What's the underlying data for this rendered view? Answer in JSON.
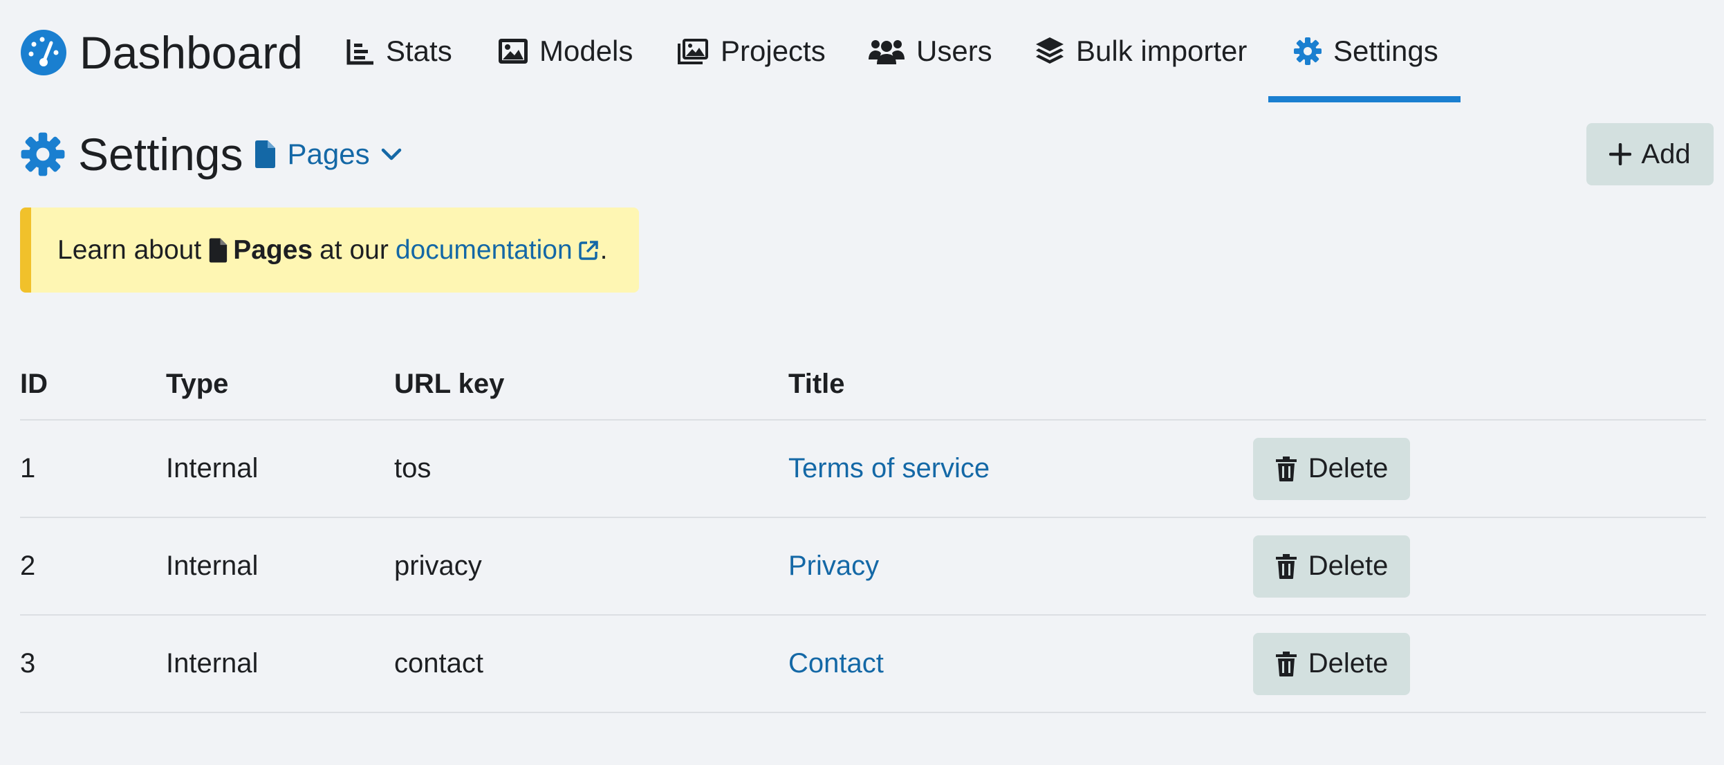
{
  "nav": {
    "brand": "Dashboard",
    "items": [
      {
        "label": "Stats",
        "icon": "chart-icon"
      },
      {
        "label": "Models",
        "icon": "image-icon"
      },
      {
        "label": "Projects",
        "icon": "images-icon"
      },
      {
        "label": "Users",
        "icon": "users-icon"
      },
      {
        "label": "Bulk importer",
        "icon": "layers-icon"
      },
      {
        "label": "Settings",
        "icon": "gear-icon"
      }
    ],
    "active": "Settings"
  },
  "header": {
    "title": "Settings",
    "section": "Pages",
    "add_label": "Add"
  },
  "callout": {
    "prefix": "Learn about",
    "entity": "Pages",
    "middle": "at our",
    "link": "documentation",
    "suffix": "."
  },
  "table": {
    "columns": [
      "ID",
      "Type",
      "URL key",
      "Title"
    ],
    "rows": [
      {
        "id": "1",
        "type": "Internal",
        "url_key": "tos",
        "title": "Terms of service",
        "action": "Delete"
      },
      {
        "id": "2",
        "type": "Internal",
        "url_key": "privacy",
        "title": "Privacy",
        "action": "Delete"
      },
      {
        "id": "3",
        "type": "Internal",
        "url_key": "contact",
        "title": "Contact",
        "action": "Delete"
      }
    ]
  },
  "colors": {
    "accent": "#1a7fd0",
    "link": "#1468a6",
    "button_bg": "#d3e0df",
    "callout_bg": "#fef6b3",
    "callout_border": "#f1c12b",
    "page_bg": "#f1f3f6"
  }
}
